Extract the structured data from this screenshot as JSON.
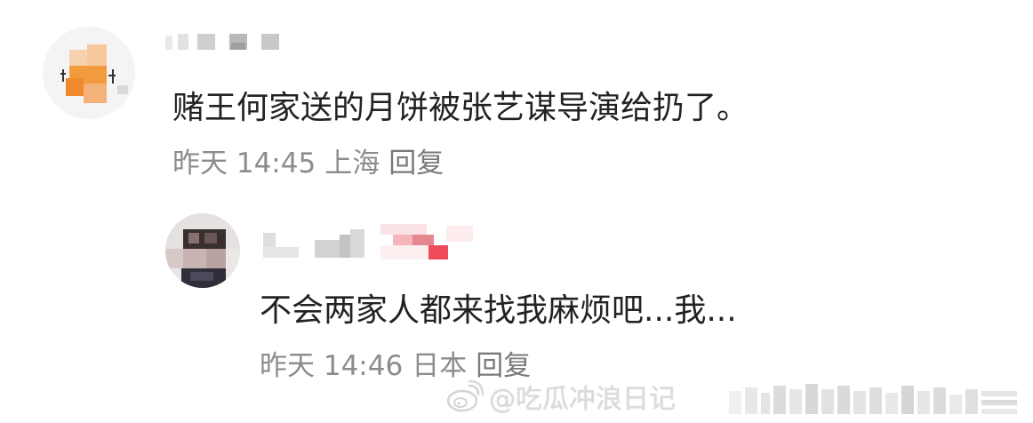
{
  "comments": [
    {
      "text": "赌王何家送的月饼被张艺谋导演给扔了。",
      "meta": {
        "time": "昨天 14:45",
        "location": "上海",
        "reply_label": "回复"
      }
    },
    {
      "text": "不会两家人都来找我麻烦吧...我...",
      "meta": {
        "time": "昨天 14:46",
        "location": "日本",
        "reply_label": "回复"
      }
    }
  ],
  "watermark": {
    "text": "@吃瓜冲浪日记",
    "icon": "weibo-logo-icon"
  },
  "colors": {
    "text": "#222222",
    "meta": "#8c8c8c",
    "watermark": "#d8d8d8",
    "background": "#ffffff"
  }
}
